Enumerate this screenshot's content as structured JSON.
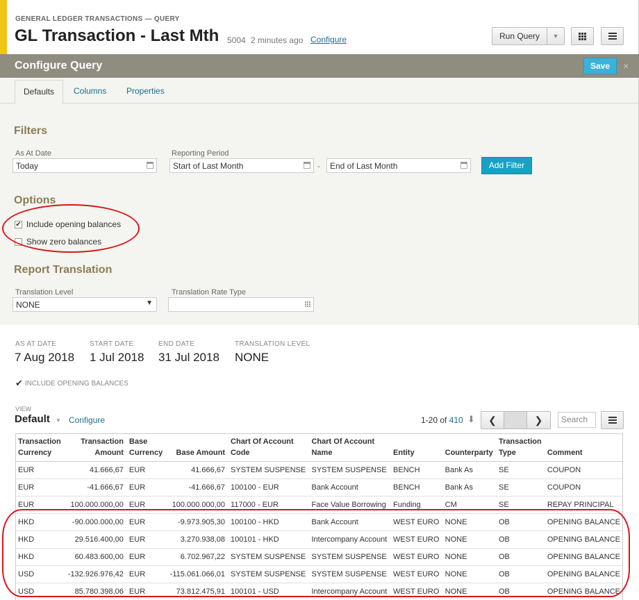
{
  "header": {
    "subtitle": "GENERAL LEDGER TRANSACTIONS — QUERY",
    "title": "GL Transaction - Last Mth",
    "record_id": "5004",
    "updated": "2 minutes ago",
    "configure_label": "Configure",
    "run_query_label": "Run Query",
    "accent_color": "#f0c419"
  },
  "panel": {
    "title": "Configure Query",
    "save_label": "Save",
    "close_label": "×",
    "tabs": [
      {
        "label": "Defaults",
        "active": true
      },
      {
        "label": "Columns",
        "active": false
      },
      {
        "label": "Properties",
        "active": false
      }
    ]
  },
  "filters": {
    "title": "Filters",
    "as_at_date_label": "As At Date",
    "as_at_date_value": "Today",
    "reporting_period_label": "Reporting Period",
    "period_start_value": "Start of Last Month",
    "period_separator": "-",
    "period_end_value": "End of Last Month",
    "add_filter_label": "Add Filter"
  },
  "options": {
    "title": "Options",
    "include_opening_label": "Include opening balances",
    "include_opening_checked": true,
    "show_zero_label": "Show zero balances",
    "show_zero_checked": false
  },
  "translation": {
    "title": "Report Translation",
    "level_label": "Translation Level",
    "level_value": "NONE",
    "rate_type_label": "Translation Rate Type",
    "rate_type_value": ""
  },
  "summary": {
    "as_at_label": "AS AT DATE",
    "as_at_value": "7 Aug 2018",
    "start_label": "START DATE",
    "start_value": "1 Jul 2018",
    "end_label": "END DATE",
    "end_value": "31 Jul 2018",
    "level_label": "TRANSLATION LEVEL",
    "level_value": "NONE",
    "include_note": "INCLUDE OPENING BALANCES"
  },
  "view": {
    "label": "VIEW",
    "name": "Default",
    "configure_label": "Configure",
    "range": "1-20 of",
    "total": "410",
    "search_placeholder": "Search"
  },
  "table": {
    "columns": [
      "Transaction Currency",
      "Transaction Amount",
      "Base Currency",
      "Base Amount",
      "Chart Of Account Code",
      "Chart Of Account Name",
      "Entity",
      "Counterparty",
      "Transaction Type",
      "Comment"
    ],
    "rows": [
      [
        "EUR",
        "41.666,67",
        "EUR",
        "41.666,67",
        "SYSTEM SUSPENSE",
        "SYSTEM SUSPENSE",
        "BENCH",
        "Bank As",
        "SE",
        "COUPON"
      ],
      [
        "EUR",
        "-41.666,67",
        "EUR",
        "-41.666,67",
        "100100 - EUR",
        "Bank Account",
        "BENCH",
        "Bank As",
        "SE",
        "COUPON"
      ],
      [
        "EUR",
        "100.000.000,00",
        "EUR",
        "100.000.000,00",
        "117000 - EUR",
        "Face Value Borrowing",
        "Funding",
        "CM",
        "SE",
        "REPAY PRINCIPAL"
      ],
      [
        "HKD",
        "-90.000.000,00",
        "EUR",
        "-9.973.905,30",
        "100100 - HKD",
        "Bank Account",
        "WEST EURO",
        "NONE",
        "OB",
        "OPENING BALANCE"
      ],
      [
        "HKD",
        "29.516.400,00",
        "EUR",
        "3.270.938,08",
        "100101 - HKD",
        "Intercompany Account",
        "WEST EURO",
        "NONE",
        "OB",
        "OPENING BALANCE"
      ],
      [
        "HKD",
        "60.483.600,00",
        "EUR",
        "6.702.967,22",
        "SYSTEM SUSPENSE",
        "SYSTEM SUSPENSE",
        "WEST EURO",
        "NONE",
        "OB",
        "OPENING BALANCE"
      ],
      [
        "USD",
        "-132.926.976,42",
        "EUR",
        "-115.061.066,01",
        "SYSTEM SUSPENSE",
        "SYSTEM SUSPENSE",
        "WEST EURO",
        "NONE",
        "OB",
        "OPENING BALANCE"
      ],
      [
        "USD",
        "85.780.398,06",
        "EUR",
        "73.812.475,91",
        "100101 - USD",
        "Intercompany Account",
        "WEST EURO",
        "NONE",
        "OB",
        "OPENING BALANCE"
      ]
    ]
  },
  "colors": {
    "panel_header": "#8f8c80",
    "section_title": "#8b7d55",
    "save_button": "#3bb3d9",
    "add_filter_button": "#17a2c4",
    "link": "#1a6f8a",
    "annotation_red": "#d9161c"
  }
}
